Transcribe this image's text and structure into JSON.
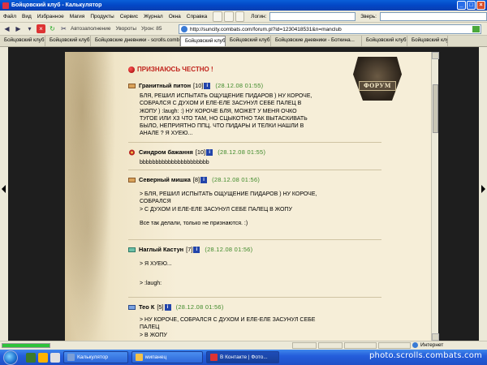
{
  "window": {
    "title": "Бойцовский клуб - Калькулятор"
  },
  "menu": {
    "items": [
      "Файл",
      "Вид",
      "Избранное",
      "Магия",
      "Продукты",
      "Сервис",
      "Журнал",
      "Окна",
      "Справка"
    ],
    "login_label": "Логин:",
    "beast_label": "Зверь:"
  },
  "nav": {
    "autofill": "Автозаполнение",
    "dodge": "Увороты",
    "damage": "Урон: 85",
    "address": "http://suncity.combats.com/forum.pl?id=1230418531&n=manclub"
  },
  "tabs": [
    "Бойцовский клуб",
    "Бойцовский клуб",
    "Бойцовские дневники - scrolls.combats.com",
    "Бойцовский клуб",
    "Бойцовский клуб",
    "Бойцовские дневники - Боткина...",
    "Бойцовский клуб",
    "Бойцовский клуб"
  ],
  "forum": {
    "logo_text": "ФОРУМ",
    "thread_title": "ПРИЗНАЮСЬ ЧЕСТНО !",
    "posts": [
      {
        "nick": "Гранитный питон",
        "level": "[10]",
        "date": "(28.12.08 01:55)",
        "lines": [
          "БЛЯ, РЕШИЛ ИСПЫТАТЬ ОЩУЩЕНИЕ ПИДАРОВ ) НУ КОРОЧЕ,",
          "СОБРАЛСЯ С ДУХОМ И ЕЛЕ-ЕЛЕ ЗАСУНУЛ СЕБЕ ПАЛЕЦ В",
          "ЖОПУ ) :laugh: :) НУ КОРОЧЕ БЛЯ, МОЖЕТ У МЕНЯ ОЧКО",
          "ТУГОЕ ИЛИ ХЗ ЧТО ТАМ, НО СЦЫКОТНО ТАК ВЫТАСКИВАТЬ",
          "БЫЛО, НЕПРИЯТНО ППЦ. ЧТО ПИДАРЫ И ТЕЛКИ НАШЛИ В",
          "АНАЛЕ ? Я ХУЕЮ..."
        ]
      },
      {
        "nick": "Синдром бажання",
        "level": "[10]",
        "date": "(28.12.08 01:55)",
        "lines": [
          "bbbbbbbbbbbbbbbbbbbbbb"
        ]
      },
      {
        "nick": "Северный мишка",
        "level": "[8]",
        "date": "(28.12.08 01:56)",
        "lines": [
          "> БЛЯ, РЕШИЛ ИСПЫТАТЬ ОЩУЩЕНИЕ ПИДАРОВ ) НУ КОРОЧЕ,",
          "СОБРАЛСЯ",
          "> С ДУХОМ И ЕЛЕ-ЕЛЕ ЗАСУНУЛ СЕБЕ ПАЛЕЦ В ЖОПУ",
          "",
          "Все так делали, только не признаются. :)"
        ]
      },
      {
        "nick": "Наглый Кастун",
        "level": "[7]",
        "date": "(28.12.08 01:56)",
        "lines": [
          "> Я ХУЕЮ...",
          "",
          "> :laugh:"
        ]
      },
      {
        "nick": "Тео К",
        "level": "[5]",
        "date": "(28.12.08 01:56)",
        "lines": [
          "> НУ КОРОЧЕ, СОБРАЛСЯ С ДУХОМ И ЕЛЕ-ЕЛЕ ЗАСУНУЛ СЕБЕ",
          "ПАЛЕЦ",
          "> В ЖОПУ"
        ]
      }
    ]
  },
  "status": {
    "zone": "Интернет"
  },
  "taskbar": {
    "tasks": [
      "Калькулятор",
      "мипанец",
      "В Контакте | Фото..."
    ],
    "watermark": "photo.scrolls.combats.com"
  }
}
